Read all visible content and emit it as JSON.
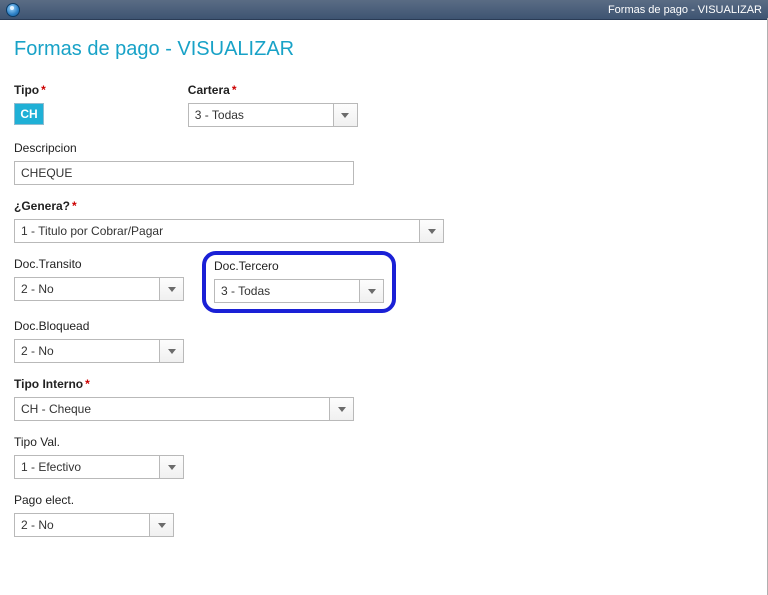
{
  "titlebar": {
    "right_text": "Formas de pago - VISUALIZAR"
  },
  "page": {
    "title": "Formas de pago - VISUALIZAR"
  },
  "fields": {
    "tipo": {
      "label": "Tipo",
      "value": "CH"
    },
    "cartera": {
      "label": "Cartera",
      "value": "3 - Todas"
    },
    "descripcion": {
      "label": "Descripcion",
      "value": "CHEQUE"
    },
    "genera": {
      "label": "¿Genera?",
      "value": "1 - Titulo por Cobrar/Pagar"
    },
    "docTransito": {
      "label": "Doc.Transito",
      "value": "2 - No"
    },
    "docTercero": {
      "label": "Doc.Tercero",
      "value": "3 - Todas"
    },
    "docBloquead": {
      "label": "Doc.Bloquead",
      "value": "2 - No"
    },
    "tipoInterno": {
      "label": "Tipo Interno",
      "value": "CH - Cheque"
    },
    "tipoVal": {
      "label": "Tipo Val.",
      "value": "1 - Efectivo"
    },
    "pagoElect": {
      "label": "Pago elect.",
      "value": "2 - No"
    }
  }
}
